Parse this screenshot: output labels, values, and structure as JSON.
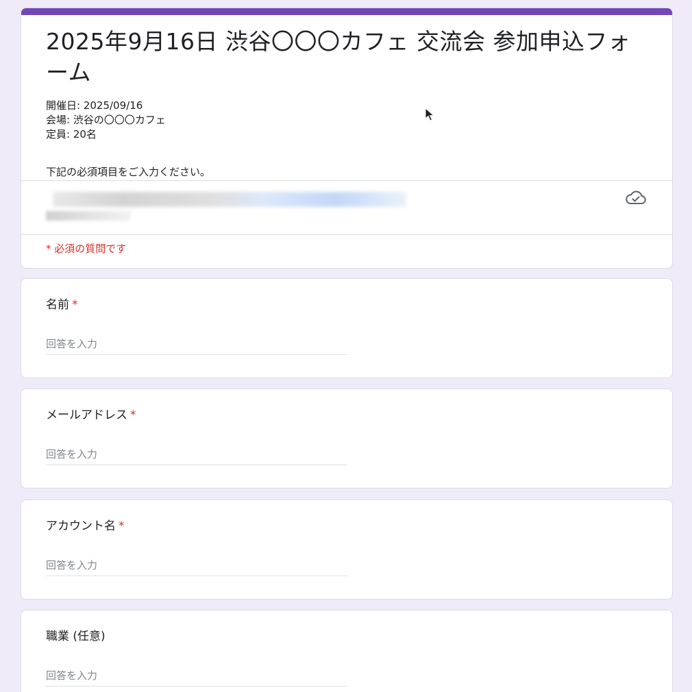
{
  "form": {
    "title": "2025年9月16日 渋谷〇〇〇カフェ 交流会 参加申込フォーム",
    "description_lines": [
      "開催日: 2025/09/16",
      "会場: 渋谷の〇〇〇カフェ",
      "定員: 20名"
    ],
    "instruction": "下記の必須項目をご入力ください。",
    "required_note": "* 必須の質問です",
    "accent_color": "#7248b9",
    "required_color": "#d93025"
  },
  "account": {
    "sync_icon": "cloud-check-icon"
  },
  "questions": [
    {
      "label": "名前",
      "required_mark": "*",
      "placeholder": "回答を入力"
    },
    {
      "label": "メールアドレス",
      "required_mark": "*",
      "placeholder": "回答を入力"
    },
    {
      "label": "アカウント名",
      "required_mark": "*",
      "placeholder": "回答を入力"
    },
    {
      "label": "職業 (任意)",
      "required_mark": "",
      "placeholder": "回答を入力"
    }
  ]
}
